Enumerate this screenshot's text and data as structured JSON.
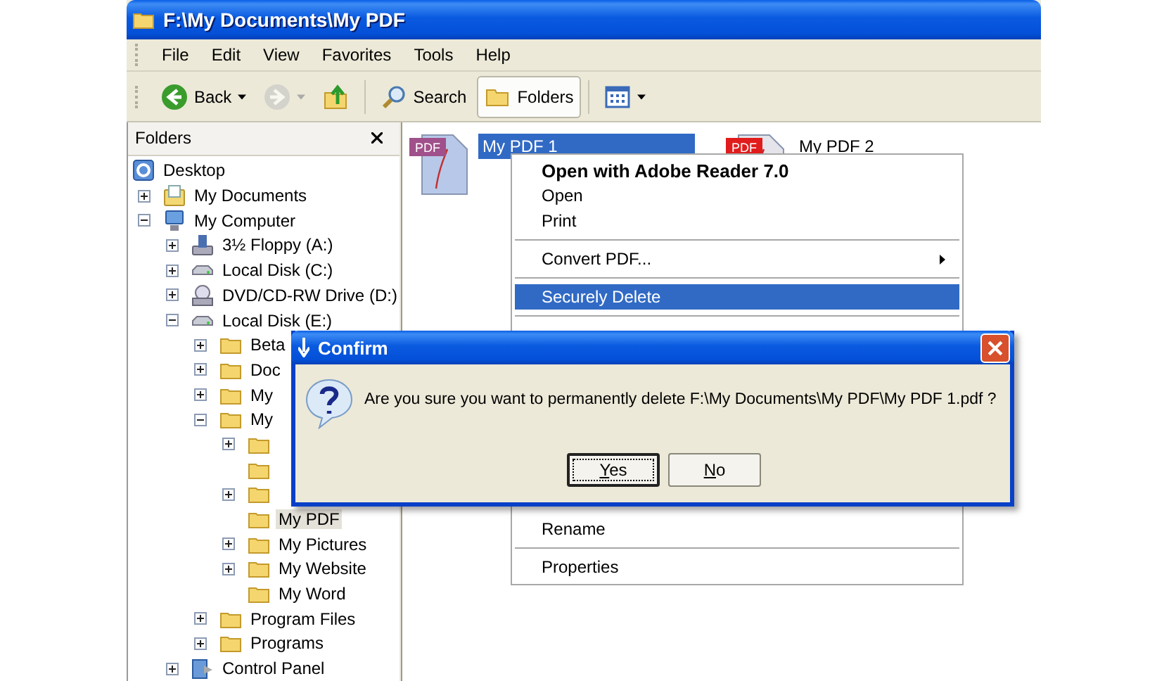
{
  "window": {
    "title": "F:\\My Documents\\My PDF"
  },
  "menu_bar": [
    "File",
    "Edit",
    "View",
    "Favorites",
    "Tools",
    "Help"
  ],
  "toolbar": [
    {
      "kind": "back",
      "label": "Back",
      "disabled": false,
      "selected": false
    },
    {
      "kind": "forward",
      "disabled": true,
      "selected": false
    },
    {
      "kind": "up",
      "disabled": false,
      "selected": false
    },
    {
      "kind": "separator"
    },
    {
      "kind": "search",
      "label": "Search",
      "disabled": false,
      "selected": false
    },
    {
      "kind": "folders",
      "label": "Folders",
      "disabled": false,
      "selected": true
    },
    {
      "kind": "separator"
    },
    {
      "kind": "views",
      "disabled": false,
      "selected": false
    }
  ],
  "folders_pane": {
    "title": "Folders"
  },
  "tree": {
    "items": [
      {
        "kind": "desktop",
        "label": "Desktop",
        "expanded": true,
        "selected": false,
        "children": [
          {
            "kind": "documents",
            "label": "My Documents",
            "expanded": false,
            "selected": false
          },
          {
            "kind": "computer",
            "label": "My Computer",
            "expanded": true,
            "selected": false,
            "children": [
              {
                "kind": "floppy",
                "label": "3½ Floppy (A:)",
                "expanded": false,
                "selected": false
              },
              {
                "kind": "disk",
                "label": "Local Disk (C:)",
                "expanded": false,
                "selected": false
              },
              {
                "kind": "cdrom",
                "label": "DVD/CD-RW Drive (D:)",
                "expanded": false,
                "selected": false
              },
              {
                "kind": "disk",
                "label": "Local Disk (E:)",
                "expanded": true,
                "selected": false,
                "children": [
                  {
                    "kind": "folder",
                    "label": "Beta",
                    "expanded": false,
                    "selected": false
                  },
                  {
                    "kind": "folder",
                    "label": "Doc",
                    "expanded": false,
                    "selected": false
                  },
                  {
                    "kind": "folder",
                    "label": "My",
                    "expanded": false,
                    "selected": false
                  },
                  {
                    "kind": "folder",
                    "label": "My",
                    "expanded": true,
                    "selected": false,
                    "children": [
                      {
                        "kind": "folder",
                        "expanded": false
                      },
                      {
                        "kind": "folder"
                      },
                      {
                        "kind": "folder",
                        "expanded": false
                      },
                      {
                        "kind": "folder",
                        "label": "My PDF",
                        "selected": true
                      },
                      {
                        "kind": "folder",
                        "label": "My Pictures",
                        "expanded": false,
                        "selected": false
                      },
                      {
                        "kind": "folder",
                        "label": "My Website",
                        "expanded": false,
                        "selected": false
                      },
                      {
                        "kind": "folder",
                        "label": "My Word",
                        "selected": false
                      }
                    ]
                  },
                  {
                    "kind": "folder",
                    "label": "Program Files",
                    "expanded": false,
                    "selected": false
                  },
                  {
                    "kind": "folder",
                    "label": "Programs",
                    "expanded": false,
                    "selected": false
                  }
                ]
              },
              {
                "kind": "control-panel",
                "label": "Control Panel",
                "expanded": false,
                "selected": false
              }
            ]
          }
        ]
      }
    ]
  },
  "files": [
    {
      "name": "My PDF 1",
      "badge": "PDF",
      "selected": true
    },
    {
      "name": "My PDF 2",
      "badge": "PDF",
      "selected": false
    }
  ],
  "context_menu": {
    "items": [
      {
        "kind": "item",
        "label": "Open with Adobe Reader 7.0",
        "default": true,
        "submenu": false,
        "selected": false
      },
      {
        "kind": "item",
        "label": "Open",
        "default": false,
        "submenu": false,
        "selected": false
      },
      {
        "kind": "item",
        "label": "Print",
        "default": false,
        "submenu": false,
        "selected": false
      },
      {
        "kind": "separator"
      },
      {
        "kind": "item",
        "label": "Convert PDF...",
        "default": false,
        "submenu": true,
        "selected": false
      },
      {
        "kind": "separator"
      },
      {
        "kind": "item",
        "label": "Securely Delete",
        "default": false,
        "submenu": false,
        "selected": true
      },
      {
        "kind": "separator"
      }
    ],
    "lower_items": [
      {
        "kind": "item",
        "label": "Rename",
        "default": false,
        "submenu": false,
        "selected": false
      },
      {
        "kind": "separator"
      },
      {
        "kind": "item",
        "label": "Properties",
        "default": false,
        "submenu": false,
        "selected": false
      }
    ]
  },
  "dialog": {
    "title": "Confirm",
    "message": "Are you sure you want to permanently delete F:\\My Documents\\My PDF\\My PDF 1.pdf ?",
    "buttons": [
      {
        "label": "Yes",
        "default": true
      },
      {
        "label": "No",
        "default": false
      }
    ]
  }
}
